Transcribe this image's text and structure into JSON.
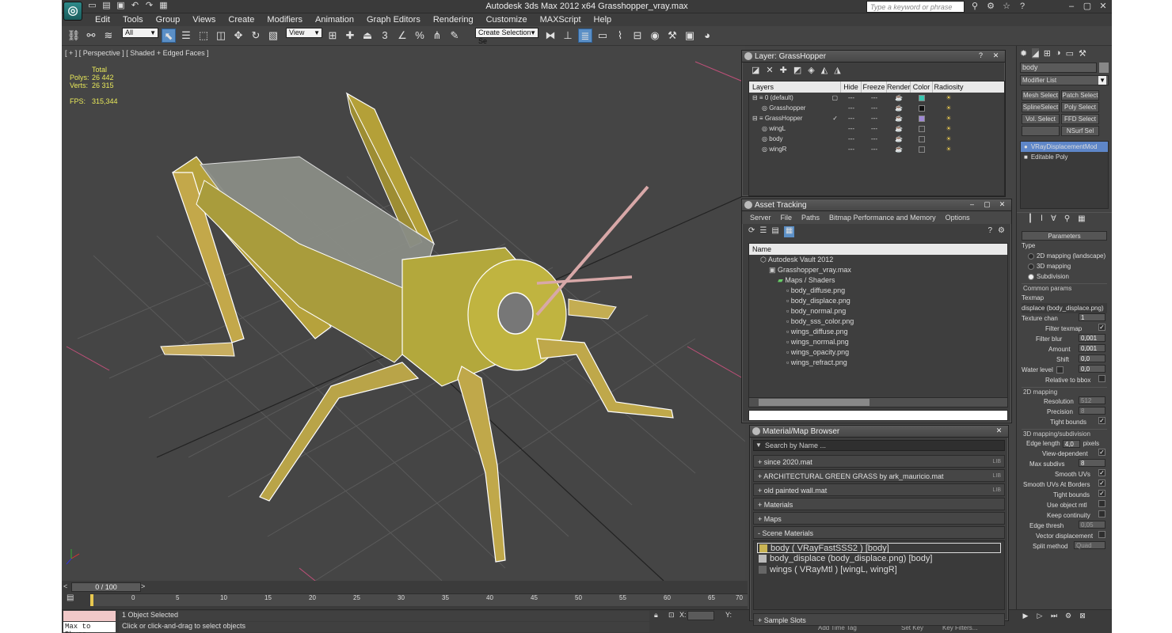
{
  "app": {
    "title": "Autodesk 3ds Max  2012 x64     Grasshopper_vray.max",
    "logo": "3ds-max-logo"
  },
  "search": {
    "placeholder": "Type a keyword or phrase"
  },
  "menu": [
    "Edit",
    "Tools",
    "Group",
    "Views",
    "Create",
    "Modifiers",
    "Animation",
    "Graph Editors",
    "Rendering",
    "Customize",
    "MAXScript",
    "Help"
  ],
  "toolbar": {
    "selection_filter": "All",
    "ref_coord": "View",
    "named_selection": "Create Selection Se",
    "snap_3": "3",
    "snap_angle": "∠",
    "snap_percent": "%"
  },
  "viewport": {
    "label": "[ + ] [ Perspective ] [ Shaded + Edged Faces ]",
    "stats": {
      "total_label": "Total",
      "polys_label": "Polys:",
      "polys": "26 442",
      "verts_label": "Verts:",
      "verts": "26 315",
      "fps_label": "FPS:",
      "fps": "315,344"
    }
  },
  "timeline": {
    "frame": "0 / 100",
    "ticks": [
      "0",
      "5",
      "10",
      "15",
      "20",
      "25",
      "30",
      "35",
      "40",
      "45",
      "50",
      "55",
      "60",
      "65",
      "70"
    ]
  },
  "status": {
    "maxscript": "Max to Physc.",
    "selected": "1 Object Selected",
    "prompt": "Click or click-and-drag to select objects",
    "x_label": "X:",
    "y_label": "Y:",
    "add_time_tag": "Add Time Tag",
    "set_key": "Set Key",
    "key_filters": "Key Filters..."
  },
  "layer_panel": {
    "title": "Layer: GrassHopper",
    "columns": [
      "Layers",
      "Hide",
      "Freeze",
      "Render",
      "Color",
      "Radiosity"
    ],
    "rows": [
      {
        "name": "0 (default)",
        "indent": 0,
        "color": "#38c7b1",
        "current": "▢"
      },
      {
        "name": "Grasshopper",
        "indent": 1,
        "color": "#111111",
        "current": ""
      },
      {
        "name": "GrassHopper",
        "indent": 0,
        "color": "#a089d6",
        "current": "✓"
      },
      {
        "name": "wingL",
        "indent": 1,
        "color": "#3e3e3e",
        "current": ""
      },
      {
        "name": "body",
        "indent": 1,
        "color": "#3e3e3e",
        "current": ""
      },
      {
        "name": "wingR",
        "indent": 1,
        "color": "#3e3e3e",
        "current": ""
      }
    ]
  },
  "asset_panel": {
    "title": "Asset Tracking",
    "menu": [
      "Server",
      "File",
      "Paths",
      "Bitmap Performance and Memory",
      "Options"
    ],
    "column": "Name",
    "rows": [
      {
        "name": "Autodesk Vault 2012",
        "indent": 0
      },
      {
        "name": "Grasshopper_vray.max",
        "indent": 1
      },
      {
        "name": "Maps / Shaders",
        "indent": 2
      },
      {
        "name": "body_diffuse.png",
        "indent": 3
      },
      {
        "name": "body_displace.png",
        "indent": 3
      },
      {
        "name": "body_normal.png",
        "indent": 3
      },
      {
        "name": "body_sss_color.png",
        "indent": 3
      },
      {
        "name": "wings_diffuse.png",
        "indent": 3
      },
      {
        "name": "wings_normal.png",
        "indent": 3
      },
      {
        "name": "wings_opacity.png",
        "indent": 3
      },
      {
        "name": "wings_refract.png",
        "indent": 3
      }
    ]
  },
  "material_panel": {
    "title": "Material/Map Browser",
    "search": "Search by Name ...",
    "groups": [
      {
        "label": "+ since 2020.mat",
        "lib": "LIB"
      },
      {
        "label": "+ ARCHITECTURAL GREEN GRASS by ark_mauricio.mat",
        "lib": "LIB"
      },
      {
        "label": "+ old painted wall.mat",
        "lib": "LIB"
      },
      {
        "label": "+ Materials",
        "lib": ""
      },
      {
        "label": "+ Maps",
        "lib": ""
      },
      {
        "label": "- Scene Materials",
        "lib": ""
      }
    ],
    "scene_materials": [
      "body  ( VRayFastSSS2 )  [body]",
      "body_displace (body_displace.png)  [body]",
      "wings  ( VRayMtl )  [wingL, wingR]"
    ],
    "sample_slots": "+ Sample Slots"
  },
  "command_panel": {
    "object_name": "body",
    "modifier_list": "Modifier List",
    "buttons": [
      "Mesh Select",
      "Patch Select",
      "SplineSelect",
      "Poly Select",
      "Vol. Select",
      "FFD Select",
      "",
      "NSurf Sel"
    ],
    "stack": [
      "VRayDisplacementMod",
      "Editable Poly"
    ],
    "parameters": "Parameters",
    "type_label": "Type",
    "type_options": [
      "2D mapping (landscape)",
      "3D mapping",
      "Subdivision"
    ],
    "common": "Common params",
    "texmap_label": "Texmap",
    "texmap": "displace (body_displace.png)",
    "texture_chan_label": "Texture chan",
    "texture_chan": "1",
    "filter_texmap": "Filter texmap",
    "filter_blur_label": "Filter blur",
    "filter_blur": "0,001",
    "amount_label": "Amount",
    "amount": "0,001",
    "shift_label": "Shift",
    "shift": "0,0",
    "water_label": "Water level",
    "water": "0,0",
    "relative_bbox": "Relative to bbox",
    "map2d": "2D mapping",
    "resolution_label": "Resolution",
    "resolution": "512",
    "precision_label": "Precision",
    "precision": "8",
    "tight_bounds_2d": "Tight bounds",
    "map3d": "3D mapping/subdivision",
    "edge_length_label": "Edge length",
    "edge_length": "4,0",
    "pixels": "pixels",
    "view_dependent": "View-dependent",
    "max_subdivs_label": "Max subdivs",
    "max_subdivs": "8",
    "smooth_uvs": "Smooth UVs",
    "smooth_uvs_borders": "Smooth UVs At Borders",
    "tight_bounds": "Tight bounds",
    "use_object_mtl": "Use object mtl",
    "keep_continuity": "Keep continuity",
    "edge_thresh_label": "Edge thresh",
    "edge_thresh": "0,05",
    "vector_disp": "Vector displacement",
    "split_label": "Split method",
    "split": "Quad"
  }
}
